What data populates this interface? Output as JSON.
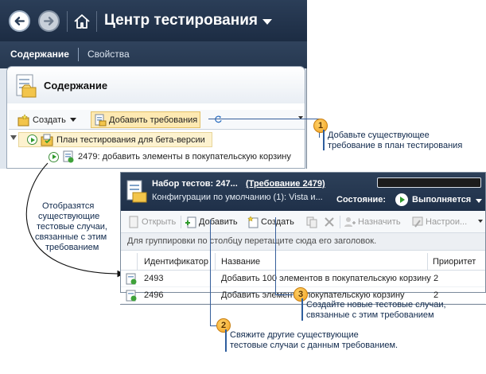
{
  "main_window": {
    "title": "Центр тестирования",
    "tabs": [
      "Содержание",
      "Свойства"
    ],
    "panel_title": "Содержание",
    "toolbar": {
      "create_label": "Создать",
      "add_requirements_label": "Добавить требования"
    },
    "tree": {
      "plan": "План тестирования для бета-версии",
      "suite": "2479: добавить элементы в покупательскую корзину"
    }
  },
  "test_suite_window": {
    "title": "Набор тестов: 247...",
    "requirement_link": "(Требование 2479)",
    "configurations": "Конфигурации по умолчанию (1): Vista и...",
    "state_label": "Состояние:",
    "state_value": "Выполняется",
    "toolbar": {
      "open_label": "Открыть",
      "add_label": "Добавить",
      "create_label": "Создать",
      "assign_label": "Назначить",
      "configure_label": "Настрои..."
    },
    "group_hint": "Для группировки по столбцу перетащите сюда его заголовок.",
    "columns": [
      "Идентификатор",
      "Название",
      "Приоритет"
    ],
    "rows": [
      {
        "id": "2493",
        "name": "Добавить 100 элементов в покупательскую корзину",
        "priority": "2"
      },
      {
        "id": "2496",
        "name": "Добавить элемент в покупательскую корзину",
        "priority": "2"
      }
    ]
  },
  "callouts": {
    "one_number": "1",
    "one_text": [
      "Добавьте существующее",
      "требование в план тестирования"
    ],
    "left_note": [
      "Отобразятся",
      "существующие",
      "тестовые случаи,",
      "связанные с этим",
      "требованием"
    ],
    "three_number": "3",
    "three_text": [
      "Создайте новые тестовые случаи,",
      "связанные с этим требованием"
    ],
    "two_number": "2",
    "two_text": [
      "Свяжите другие существующие",
      "тестовые случаи с данным требованием."
    ]
  },
  "colors": {
    "title_bar": "#1f3049",
    "callout_badge": "#f2a020",
    "callout_text": "#10294c",
    "leader_line": "#375f9b",
    "highlight": "#fdf2cf"
  },
  "icons": [
    "back-arrow-icon",
    "forward-arrow-icon",
    "home-icon",
    "dropdown-caret-icon",
    "content-panel-icon",
    "create-icon",
    "add-requirements-icon",
    "refresh-icon",
    "expand-triangle-icon",
    "run-status-icon",
    "test-plan-icon",
    "test-suite-icon",
    "test-case-icon",
    "delete-icon",
    "assign-icon",
    "configure-icon"
  ]
}
